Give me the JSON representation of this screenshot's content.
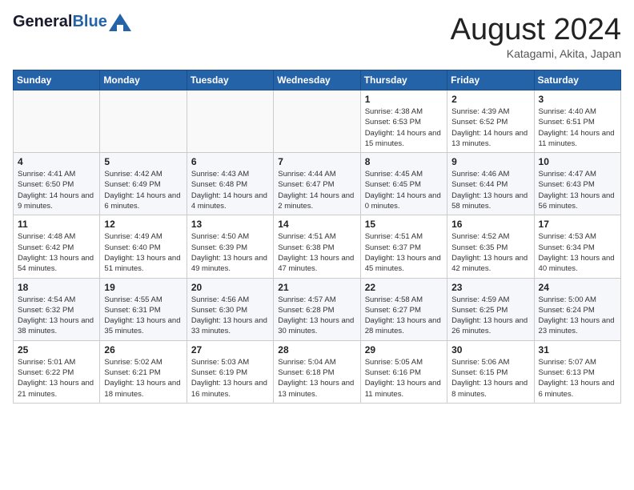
{
  "header": {
    "logo_general": "General",
    "logo_blue": "Blue",
    "month_year": "August 2024",
    "location": "Katagami, Akita, Japan"
  },
  "days_of_week": [
    "Sunday",
    "Monday",
    "Tuesday",
    "Wednesday",
    "Thursday",
    "Friday",
    "Saturday"
  ],
  "weeks": [
    [
      {
        "day": "",
        "sunrise": "",
        "sunset": "",
        "daylight": ""
      },
      {
        "day": "",
        "sunrise": "",
        "sunset": "",
        "daylight": ""
      },
      {
        "day": "",
        "sunrise": "",
        "sunset": "",
        "daylight": ""
      },
      {
        "day": "",
        "sunrise": "",
        "sunset": "",
        "daylight": ""
      },
      {
        "day": "1",
        "sunrise": "Sunrise: 4:38 AM",
        "sunset": "Sunset: 6:53 PM",
        "daylight": "Daylight: 14 hours and 15 minutes."
      },
      {
        "day": "2",
        "sunrise": "Sunrise: 4:39 AM",
        "sunset": "Sunset: 6:52 PM",
        "daylight": "Daylight: 14 hours and 13 minutes."
      },
      {
        "day": "3",
        "sunrise": "Sunrise: 4:40 AM",
        "sunset": "Sunset: 6:51 PM",
        "daylight": "Daylight: 14 hours and 11 minutes."
      }
    ],
    [
      {
        "day": "4",
        "sunrise": "Sunrise: 4:41 AM",
        "sunset": "Sunset: 6:50 PM",
        "daylight": "Daylight: 14 hours and 9 minutes."
      },
      {
        "day": "5",
        "sunrise": "Sunrise: 4:42 AM",
        "sunset": "Sunset: 6:49 PM",
        "daylight": "Daylight: 14 hours and 6 minutes."
      },
      {
        "day": "6",
        "sunrise": "Sunrise: 4:43 AM",
        "sunset": "Sunset: 6:48 PM",
        "daylight": "Daylight: 14 hours and 4 minutes."
      },
      {
        "day": "7",
        "sunrise": "Sunrise: 4:44 AM",
        "sunset": "Sunset: 6:47 PM",
        "daylight": "Daylight: 14 hours and 2 minutes."
      },
      {
        "day": "8",
        "sunrise": "Sunrise: 4:45 AM",
        "sunset": "Sunset: 6:45 PM",
        "daylight": "Daylight: 14 hours and 0 minutes."
      },
      {
        "day": "9",
        "sunrise": "Sunrise: 4:46 AM",
        "sunset": "Sunset: 6:44 PM",
        "daylight": "Daylight: 13 hours and 58 minutes."
      },
      {
        "day": "10",
        "sunrise": "Sunrise: 4:47 AM",
        "sunset": "Sunset: 6:43 PM",
        "daylight": "Daylight: 13 hours and 56 minutes."
      }
    ],
    [
      {
        "day": "11",
        "sunrise": "Sunrise: 4:48 AM",
        "sunset": "Sunset: 6:42 PM",
        "daylight": "Daylight: 13 hours and 54 minutes."
      },
      {
        "day": "12",
        "sunrise": "Sunrise: 4:49 AM",
        "sunset": "Sunset: 6:40 PM",
        "daylight": "Daylight: 13 hours and 51 minutes."
      },
      {
        "day": "13",
        "sunrise": "Sunrise: 4:50 AM",
        "sunset": "Sunset: 6:39 PM",
        "daylight": "Daylight: 13 hours and 49 minutes."
      },
      {
        "day": "14",
        "sunrise": "Sunrise: 4:51 AM",
        "sunset": "Sunset: 6:38 PM",
        "daylight": "Daylight: 13 hours and 47 minutes."
      },
      {
        "day": "15",
        "sunrise": "Sunrise: 4:51 AM",
        "sunset": "Sunset: 6:37 PM",
        "daylight": "Daylight: 13 hours and 45 minutes."
      },
      {
        "day": "16",
        "sunrise": "Sunrise: 4:52 AM",
        "sunset": "Sunset: 6:35 PM",
        "daylight": "Daylight: 13 hours and 42 minutes."
      },
      {
        "day": "17",
        "sunrise": "Sunrise: 4:53 AM",
        "sunset": "Sunset: 6:34 PM",
        "daylight": "Daylight: 13 hours and 40 minutes."
      }
    ],
    [
      {
        "day": "18",
        "sunrise": "Sunrise: 4:54 AM",
        "sunset": "Sunset: 6:32 PM",
        "daylight": "Daylight: 13 hours and 38 minutes."
      },
      {
        "day": "19",
        "sunrise": "Sunrise: 4:55 AM",
        "sunset": "Sunset: 6:31 PM",
        "daylight": "Daylight: 13 hours and 35 minutes."
      },
      {
        "day": "20",
        "sunrise": "Sunrise: 4:56 AM",
        "sunset": "Sunset: 6:30 PM",
        "daylight": "Daylight: 13 hours and 33 minutes."
      },
      {
        "day": "21",
        "sunrise": "Sunrise: 4:57 AM",
        "sunset": "Sunset: 6:28 PM",
        "daylight": "Daylight: 13 hours and 30 minutes."
      },
      {
        "day": "22",
        "sunrise": "Sunrise: 4:58 AM",
        "sunset": "Sunset: 6:27 PM",
        "daylight": "Daylight: 13 hours and 28 minutes."
      },
      {
        "day": "23",
        "sunrise": "Sunrise: 4:59 AM",
        "sunset": "Sunset: 6:25 PM",
        "daylight": "Daylight: 13 hours and 26 minutes."
      },
      {
        "day": "24",
        "sunrise": "Sunrise: 5:00 AM",
        "sunset": "Sunset: 6:24 PM",
        "daylight": "Daylight: 13 hours and 23 minutes."
      }
    ],
    [
      {
        "day": "25",
        "sunrise": "Sunrise: 5:01 AM",
        "sunset": "Sunset: 6:22 PM",
        "daylight": "Daylight: 13 hours and 21 minutes."
      },
      {
        "day": "26",
        "sunrise": "Sunrise: 5:02 AM",
        "sunset": "Sunset: 6:21 PM",
        "daylight": "Daylight: 13 hours and 18 minutes."
      },
      {
        "day": "27",
        "sunrise": "Sunrise: 5:03 AM",
        "sunset": "Sunset: 6:19 PM",
        "daylight": "Daylight: 13 hours and 16 minutes."
      },
      {
        "day": "28",
        "sunrise": "Sunrise: 5:04 AM",
        "sunset": "Sunset: 6:18 PM",
        "daylight": "Daylight: 13 hours and 13 minutes."
      },
      {
        "day": "29",
        "sunrise": "Sunrise: 5:05 AM",
        "sunset": "Sunset: 6:16 PM",
        "daylight": "Daylight: 13 hours and 11 minutes."
      },
      {
        "day": "30",
        "sunrise": "Sunrise: 5:06 AM",
        "sunset": "Sunset: 6:15 PM",
        "daylight": "Daylight: 13 hours and 8 minutes."
      },
      {
        "day": "31",
        "sunrise": "Sunrise: 5:07 AM",
        "sunset": "Sunset: 6:13 PM",
        "daylight": "Daylight: 13 hours and 6 minutes."
      }
    ]
  ]
}
